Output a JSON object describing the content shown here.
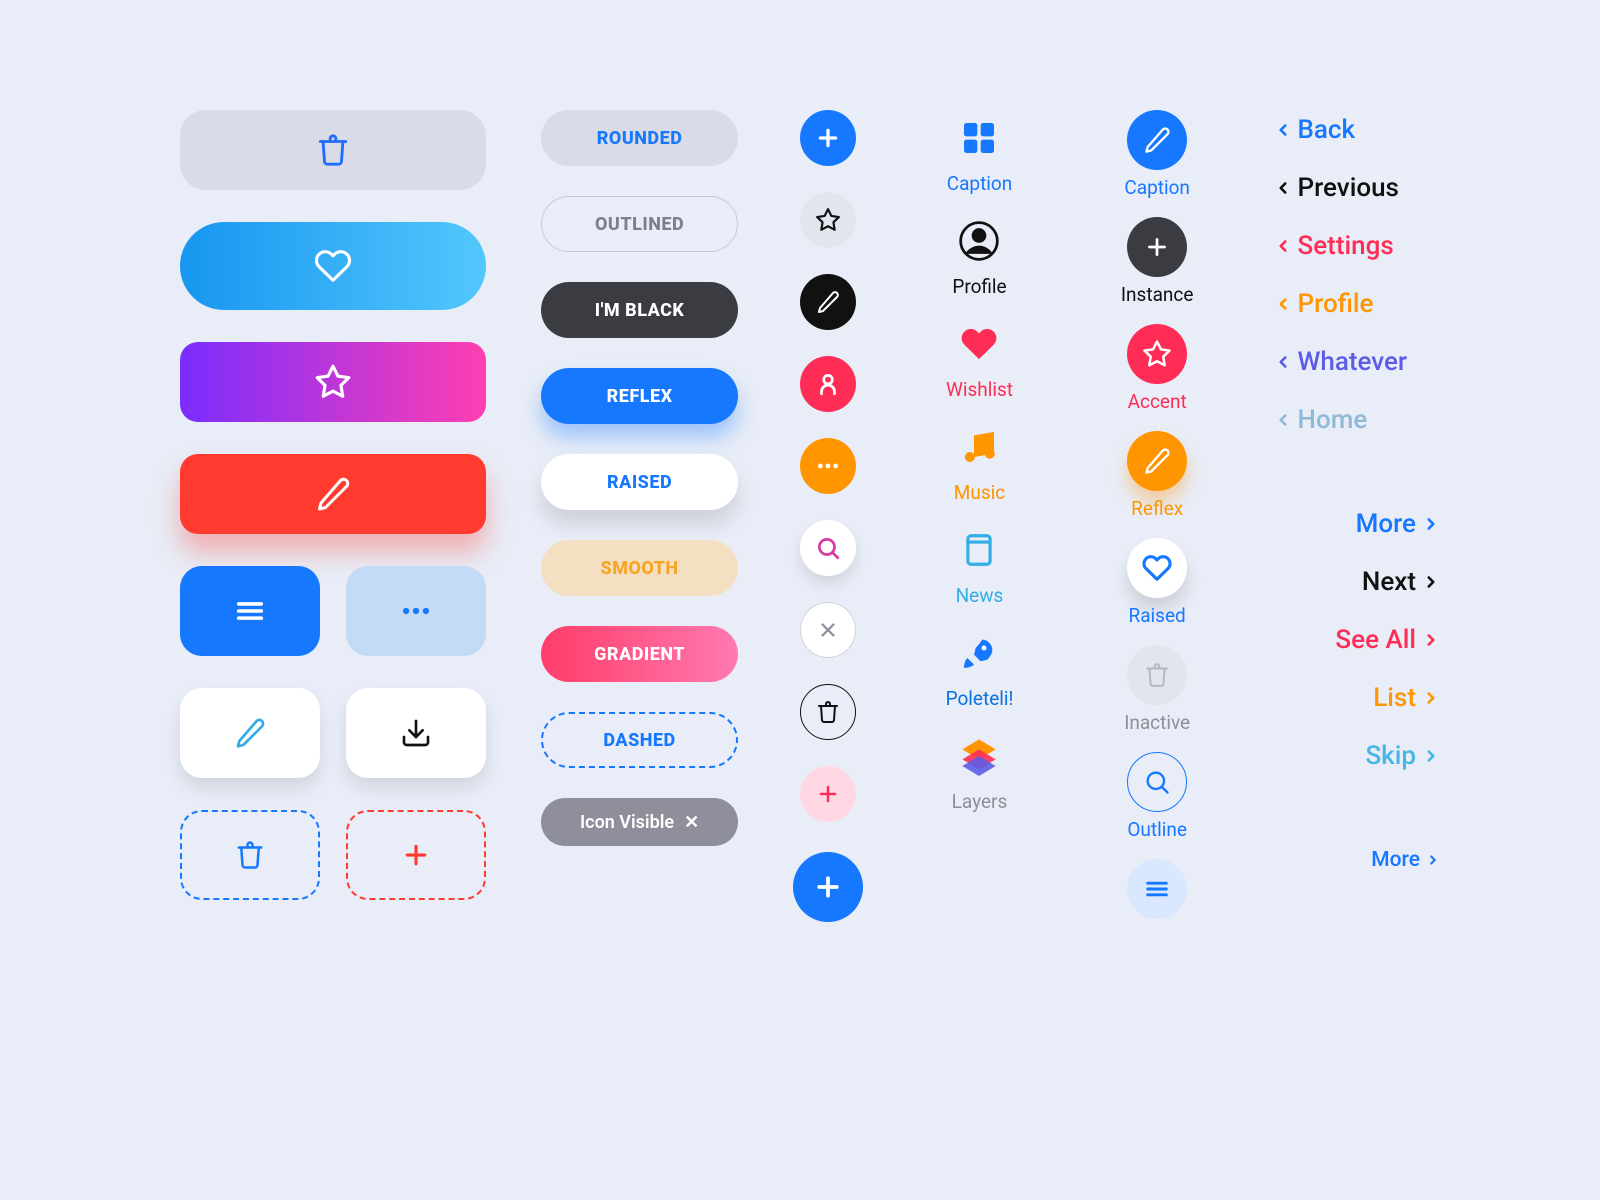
{
  "pills": {
    "rounded": "ROUNDED",
    "outlined": "OUTLINED",
    "black": "I'M BLACK",
    "reflex": "REFLEX",
    "raised": "RAISED",
    "smooth": "SMOOTH",
    "gradient": "GRADIENT",
    "dashed": "DASHED"
  },
  "chip": {
    "label": "Icon Visible"
  },
  "stacks": {
    "caption": "Caption",
    "profile": "Profile",
    "wishlist": "Wishlist",
    "music": "Music",
    "news": "News",
    "poleteli": "Poleteli!",
    "layers": "Layers"
  },
  "circleLabels": {
    "caption": "Caption",
    "instance": "Instance",
    "accent": "Accent",
    "reflex": "Reflex",
    "raised": "Raised",
    "inactive": "Inactive",
    "outline": "Outline"
  },
  "navLeft": {
    "back": "Back",
    "previous": "Previous",
    "settings": "Settings",
    "profile": "Profile",
    "whatever": "Whatever",
    "home": "Home"
  },
  "navRight": {
    "more": "More",
    "next": "Next",
    "seeall": "See All",
    "list": "List",
    "skip": "Skip",
    "more2": "More"
  }
}
